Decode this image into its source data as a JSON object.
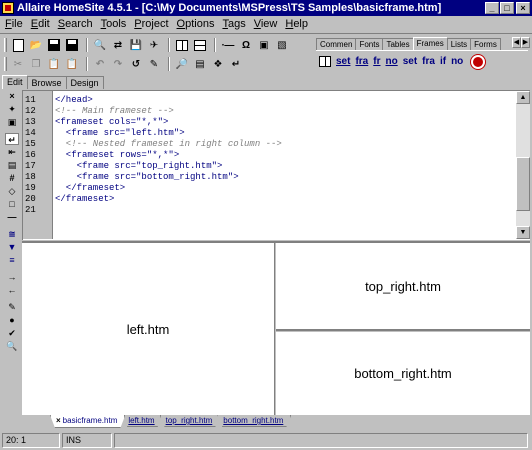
{
  "window": {
    "title": "Allaire HomeSite 4.5.1 - [C:\\My Documents\\MSPress\\TS Samples\\basicframe.htm]",
    "buttons": [
      "_",
      "□",
      "×"
    ]
  },
  "menu": [
    "File",
    "Edit",
    "Search",
    "Tools",
    "Project",
    "Options",
    "Tags",
    "View",
    "Help"
  ],
  "toolbar": {
    "row1": [
      "new-document",
      "open",
      "save",
      "save-all",
      "find",
      "replace",
      "find-in-files",
      "replace-in-files",
      "frames-1",
      "frames-2",
      "code-sweeper",
      "special-characters",
      "tag-inspector",
      "tag-chooser"
    ],
    "row2": [
      "cut",
      "copy",
      "paste",
      "paste-special",
      "undo",
      "redo",
      "refresh",
      "snippet",
      "validate",
      "spell-check",
      "check-links",
      "word-wrap"
    ]
  },
  "quickbar": {
    "tabs": [
      "Commen",
      "Fonts",
      "Tables",
      "Frames",
      "Lists",
      "Forms"
    ],
    "active_tab": "Frames",
    "buttons": [
      "set",
      "fra",
      "fr",
      "no",
      "set",
      "fra",
      "if",
      "no"
    ]
  },
  "view_tabs": [
    "Edit",
    "Browse",
    "Design"
  ],
  "editor": {
    "lines": [
      {
        "num": "11",
        "mark": "",
        "text": "</head>",
        "comment": false
      },
      {
        "num": "12",
        "mark": "",
        "text": "<!-- Main frameset -->",
        "comment": true
      },
      {
        "num": "13",
        "mark": "",
        "text": "<frameset cols=\"*,*\">",
        "comment": false
      },
      {
        "num": "14",
        "mark": "",
        "text": "  <frame src=\"left.htm\">",
        "comment": false
      },
      {
        "num": "15",
        "mark": "",
        "text": "  <!-- Nested frameset in right column -->",
        "comment": true
      },
      {
        "num": "16",
        "mark": "",
        "text": "  <frameset rows=\"*,*\">",
        "comment": false
      },
      {
        "num": "17",
        "mark": "",
        "text": "    <frame src=\"top_right.htm\">",
        "comment": false
      },
      {
        "num": "18",
        "mark": "",
        "text": "    <frame src=\"bottom_right.htm\">",
        "comment": false
      },
      {
        "num": "19",
        "mark": "",
        "text": "  </frameset>",
        "comment": false
      },
      {
        "num": "20",
        "mark": "",
        "text": "</frameset>",
        "comment": false
      },
      {
        "num": "21",
        "mark": "",
        "text": "",
        "comment": false
      }
    ],
    "scroll_position": 0.55
  },
  "preview": {
    "left": "left.htm",
    "top_right": "top_right.htm",
    "bottom_right": "bottom_right.htm"
  },
  "doc_tabs": [
    {
      "label": "basicframe.htm",
      "active": true
    },
    {
      "label": "left.htm",
      "active": false
    },
    {
      "label": "top_right.htm",
      "active": false
    },
    {
      "label": "bottom_right.htm",
      "active": false
    }
  ],
  "status": {
    "position": "20: 1",
    "mode": "INS"
  }
}
